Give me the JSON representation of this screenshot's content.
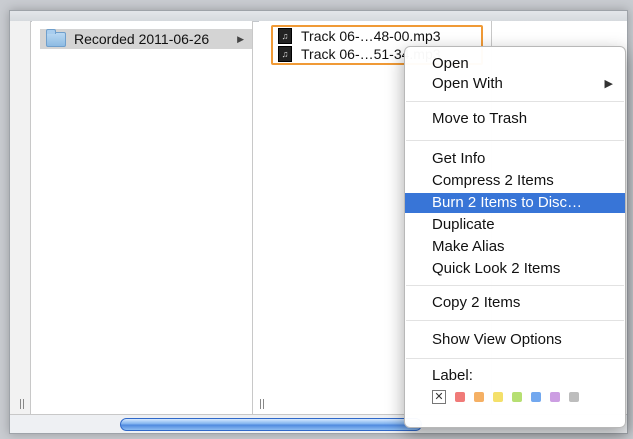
{
  "finder": {
    "folder_label": "Recorded 2011-06-26",
    "files": [
      {
        "name": "Track 06-…48-00.mp3"
      },
      {
        "name": "Track 06-…51-34.mp3"
      }
    ]
  },
  "menu": {
    "items": [
      {
        "label": "Open"
      },
      {
        "label": "Open With"
      },
      {
        "label": "Move to Trash"
      },
      {
        "label": "Get Info"
      },
      {
        "label": "Compress 2 Items"
      },
      {
        "label": "Burn 2 Items to Disc…"
      },
      {
        "label": "Duplicate"
      },
      {
        "label": "Make Alias"
      },
      {
        "label": "Quick Look 2 Items"
      },
      {
        "label": "Copy 2 Items"
      },
      {
        "label": "Show View Options"
      }
    ],
    "highlighted_item": "Burn 2 Items to Disc…",
    "label_title": "Label:",
    "label_colors": [
      {
        "name": "red",
        "hex": "#f07a78"
      },
      {
        "name": "orange",
        "hex": "#f5b064"
      },
      {
        "name": "yellow",
        "hex": "#f4e06a"
      },
      {
        "name": "green",
        "hex": "#b6df72"
      },
      {
        "name": "blue",
        "hex": "#72a8ef"
      },
      {
        "name": "purple",
        "hex": "#cc9ee2"
      },
      {
        "name": "gray",
        "hex": "#bdbdbd"
      }
    ]
  },
  "colors": {
    "highlight": "#3875d7",
    "selection_border": "#f09a36"
  }
}
